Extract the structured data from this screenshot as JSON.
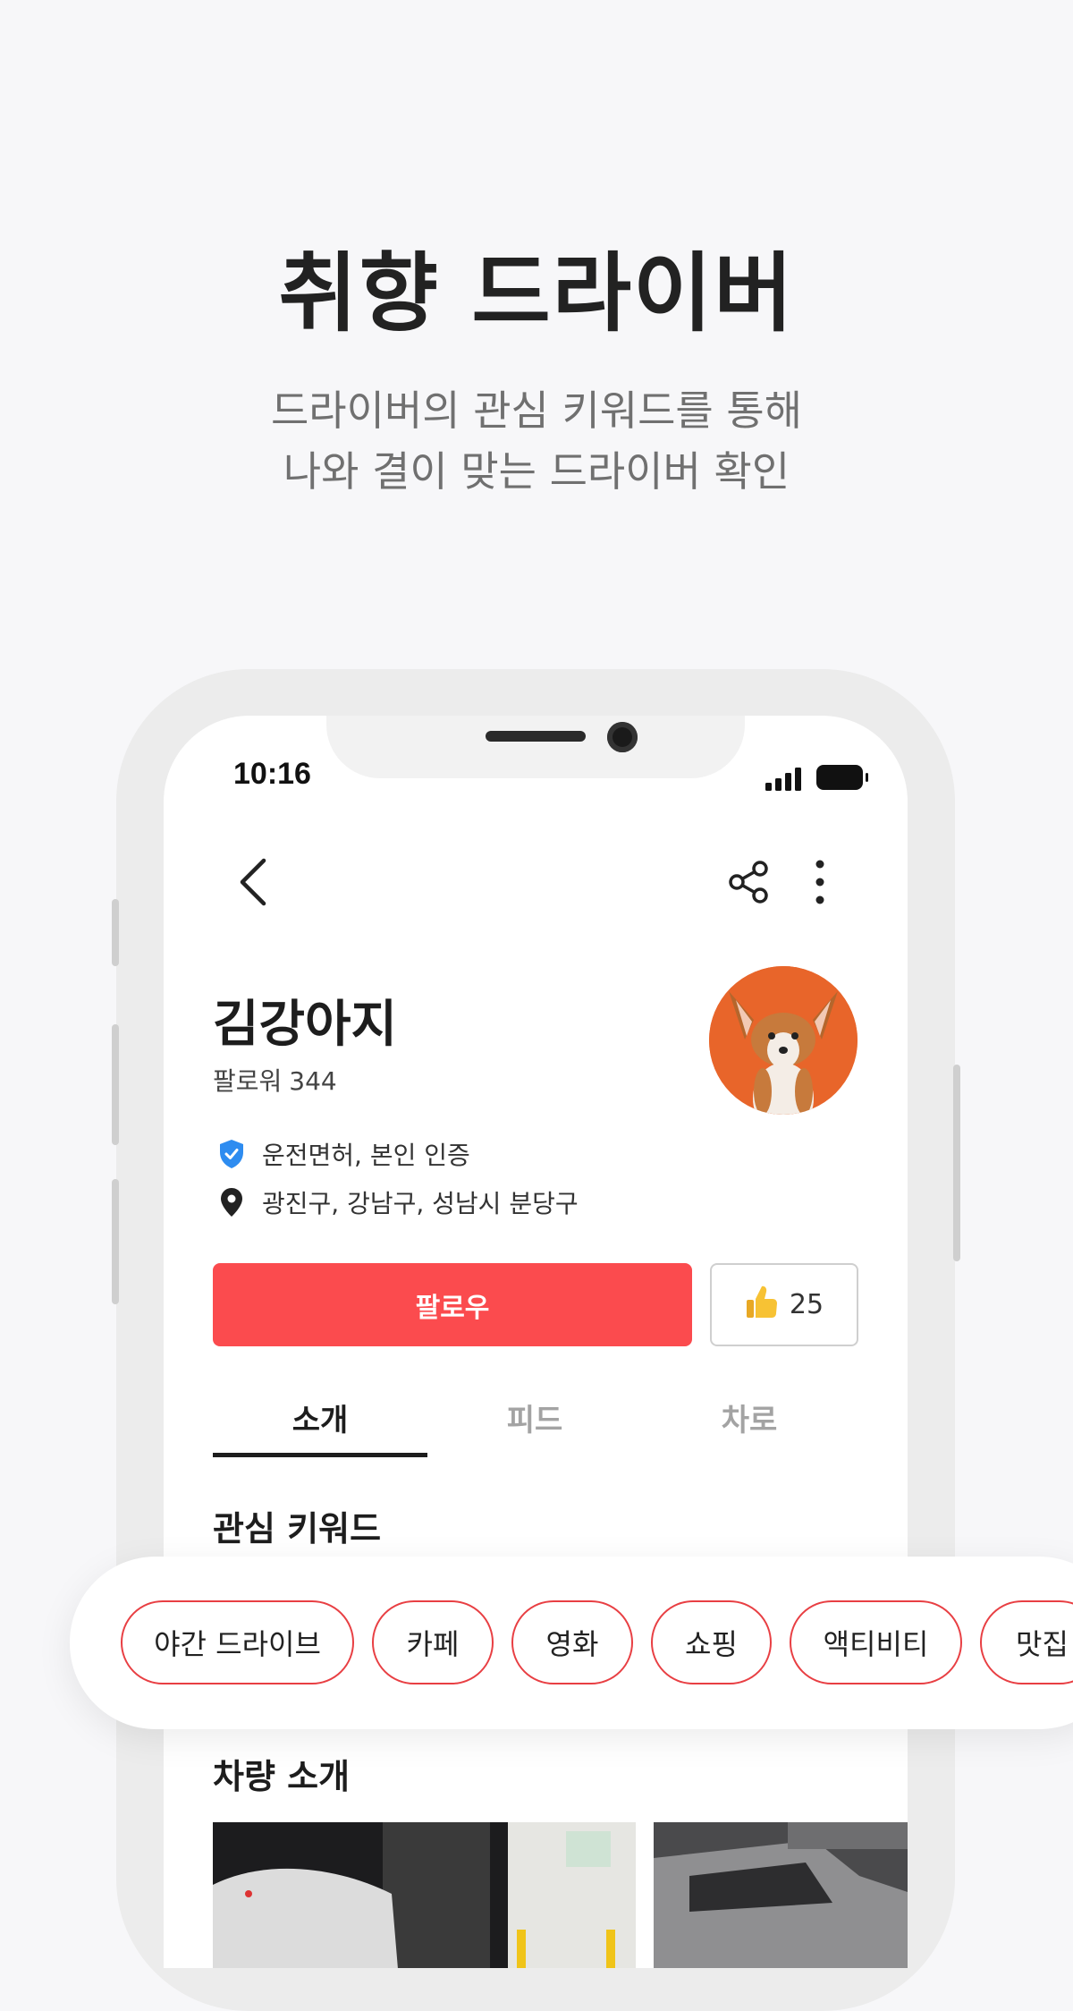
{
  "hero": {
    "title": "취향 드라이버",
    "subtitle_line1": "드라이버의 관심 키워드를 통해",
    "subtitle_line2": "나와 결이 맞는 드라이버 확인"
  },
  "status_bar": {
    "time": "10:16"
  },
  "nav": {
    "back_icon": "chevron-left-icon",
    "share_icon": "share-icon",
    "more_icon": "more-vertical-icon"
  },
  "profile": {
    "name": "김강아지",
    "followers_label": "팔로워",
    "followers_count": "344",
    "verification": "운전면허, 본인 인증",
    "location": "광진구, 강남구, 성남시 분당구"
  },
  "actions": {
    "follow_label": "팔로우",
    "like_count": "25"
  },
  "tabs": [
    {
      "label": "소개"
    },
    {
      "label": "피드"
    },
    {
      "label": "차로"
    }
  ],
  "sections": {
    "keywords_title": "관심 키워드",
    "car_title": "차량 소개"
  },
  "keywords": [
    {
      "label": "야간 드라이브"
    },
    {
      "label": "카페"
    },
    {
      "label": "영화"
    },
    {
      "label": "쇼핑"
    },
    {
      "label": "액티비티"
    },
    {
      "label": "맛집"
    }
  ],
  "colors": {
    "accent": "#fb4b4e",
    "chip_border": "#e83f43",
    "verified": "#2e8cf0"
  }
}
